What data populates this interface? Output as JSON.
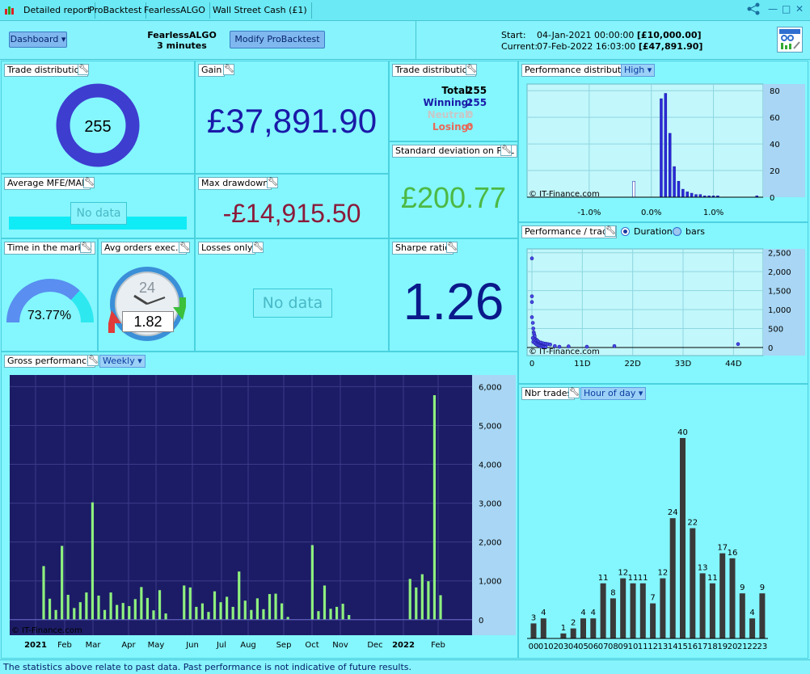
{
  "titlebar": {
    "tabs": [
      "Detailed report",
      "ProBacktest",
      "FearlessALGO",
      "Wall Street Cash (£1)"
    ]
  },
  "toolbar": {
    "dashboard_label": "Dashboard",
    "strategy_name": "FearlessALGO",
    "timeframe": "3 minutes",
    "modify_label": "Modify ProBacktest",
    "start_label": "Start:",
    "start_date": "04-Jan-2021 00:00:00",
    "start_value": "[£10,000.00]",
    "current_label": "Current:",
    "current_date": "07-Feb-2022 16:03:00",
    "current_value": "[£47,891.90]"
  },
  "trade_distribution": {
    "title": "Trade distribution",
    "total_trades": "255"
  },
  "gain": {
    "title": "Gain",
    "value": "£37,891.90"
  },
  "trade_counts": {
    "title": "Trade distribution",
    "total_label": "Total:",
    "total": "255",
    "winning_label": "Winning:",
    "winning": "255",
    "neutral_label": "Neutral:",
    "neutral": "0",
    "losing_label": "Losing:",
    "losing": "0"
  },
  "mfe_mae": {
    "title": "Average MFE/MAE",
    "nodata": "No data"
  },
  "max_drawdown": {
    "title": "Max drawdown",
    "value": "-£14,915.50"
  },
  "std_dev": {
    "title": "Standard deviation on P&L",
    "value": "£200.77"
  },
  "time_market": {
    "title": "Time in the market",
    "value": "73.77%",
    "fraction": 0.7377
  },
  "avg_orders": {
    "title": "Avg orders exec...",
    "clock": "24",
    "value": "1.82"
  },
  "losses_only": {
    "title": "Losses only",
    "nodata": "No data"
  },
  "sharpe": {
    "title": "Sharpe ratio",
    "value": "1.26"
  },
  "perf_dist": {
    "title": "Performance distribution",
    "dropdown": "High",
    "watermark": "© IT-Finance.com"
  },
  "perf_trade": {
    "title": "Performance / trade",
    "radio_duration": "Duration",
    "radio_bars": "bars",
    "watermark": "© IT-Finance.com"
  },
  "gross": {
    "title": "Gross performance",
    "dropdown": "Weekly",
    "watermark": "© IT-Finance.com"
  },
  "nbr_trades": {
    "title": "Nbr trades",
    "dropdown": "Hour of day"
  },
  "footer": {
    "text": "The statistics above relate to past data. Past performance is not indicative of future results."
  },
  "colors": {
    "background": "#7ff2fc",
    "gain": "#1a1aa8",
    "drawdown": "#8b1a3a",
    "stddev": "#4cb944",
    "sharpe": "#0a1a8a",
    "bar_green": "#8ef07e",
    "bar_dark": "#3a3a3a"
  },
  "chart_data": [
    {
      "type": "bar",
      "id": "perf_distribution",
      "x": [
        -0.003,
        0.0007,
        0.0014,
        0.0021,
        0.0028,
        0.0035,
        0.0042,
        0.0049,
        0.0056,
        0.0063,
        0.007,
        0.0077,
        0.0084,
        0.0091,
        0.0098,
        0.0105,
        0.0112,
        0.0119,
        0.0126,
        0.0133,
        0.0168
      ],
      "values": [
        12,
        0,
        74,
        78,
        48,
        23,
        12,
        6,
        4,
        3,
        2,
        2,
        1,
        1,
        1,
        1,
        0,
        0,
        0,
        0,
        1
      ],
      "xticks": [
        "-1.0%",
        "0.0%",
        "1.0%"
      ],
      "yticks": [
        0,
        20,
        40,
        60,
        80
      ],
      "ylim": [
        0,
        85
      ]
    },
    {
      "type": "scatter",
      "id": "perf_per_trade",
      "xticks": [
        "0",
        "11D",
        "22D",
        "33D",
        "44D"
      ],
      "yticks": [
        "0",
        "500",
        "1,000",
        "1,500",
        "2,000",
        "2,500"
      ],
      "ylim": [
        0,
        2600
      ],
      "xlim": [
        0,
        48
      ],
      "points": [
        [
          0,
          2350
        ],
        [
          0,
          1350
        ],
        [
          0,
          1200
        ],
        [
          0,
          800
        ],
        [
          0.2,
          650
        ],
        [
          0.3,
          500
        ],
        [
          0.4,
          400
        ],
        [
          0.5,
          350
        ],
        [
          0.6,
          300
        ],
        [
          0.2,
          250
        ],
        [
          0.8,
          220
        ],
        [
          1,
          200
        ],
        [
          1.2,
          180
        ],
        [
          1.5,
          150
        ],
        [
          2,
          130
        ],
        [
          2.5,
          110
        ],
        [
          3,
          100
        ],
        [
          3.5,
          90
        ],
        [
          0.5,
          200
        ],
        [
          0.7,
          160
        ],
        [
          1,
          120
        ],
        [
          1.3,
          100
        ],
        [
          1.6,
          80
        ],
        [
          1.9,
          60
        ],
        [
          2.2,
          50
        ],
        [
          0.3,
          150
        ],
        [
          0.6,
          120
        ],
        [
          0.9,
          90
        ],
        [
          1.2,
          70
        ],
        [
          1.5,
          50
        ],
        [
          1.8,
          40
        ],
        [
          2.1,
          30
        ],
        [
          2.4,
          20
        ],
        [
          2.7,
          15
        ],
        [
          3,
          10
        ],
        [
          4,
          80
        ],
        [
          5,
          40
        ],
        [
          6,
          20
        ],
        [
          8,
          30
        ],
        [
          12,
          20
        ],
        [
          18,
          40
        ],
        [
          45,
          90
        ]
      ]
    },
    {
      "type": "bar",
      "id": "gross_performance",
      "yticks": [
        "0",
        "1,000",
        "2,000",
        "3,000",
        "4,000",
        "5,000",
        "6,000"
      ],
      "ylim": [
        -400,
        6300
      ],
      "xticks": [
        "2021",
        "Feb",
        "Mar",
        "Apr",
        "May",
        "Jun",
        "Jul",
        "Aug",
        "Sep",
        "Oct",
        "Nov",
        "Dec",
        "2022",
        "Feb"
      ],
      "values": [
        1380,
        540,
        250,
        1900,
        640,
        300,
        450,
        700,
        3020,
        620,
        250,
        700,
        380,
        430,
        350,
        530,
        840,
        560,
        240,
        760,
        160,
        0,
        0,
        880,
        830,
        330,
        420,
        200,
        730,
        450,
        590,
        330,
        1240,
        490,
        250,
        550,
        270,
        660,
        670,
        420,
        70,
        0,
        0,
        0,
        1920,
        220,
        880,
        280,
        330,
        410,
        120,
        0,
        0,
        0,
        0,
        0,
        0,
        0,
        0,
        0,
        1050,
        830,
        1170,
        990,
        5780,
        630
      ]
    },
    {
      "type": "bar",
      "id": "nbr_trades_hour",
      "categories": [
        "00",
        "01",
        "02",
        "03",
        "04",
        "05",
        "06",
        "07",
        "08",
        "09",
        "10",
        "11",
        "12",
        "13",
        "14",
        "15",
        "16",
        "17",
        "18",
        "19",
        "20",
        "21",
        "22",
        "23"
      ],
      "values": [
        3,
        4,
        0,
        1,
        2,
        4,
        4,
        11,
        8,
        12,
        11,
        11,
        7,
        12,
        24,
        40,
        22,
        13,
        11,
        17,
        16,
        9,
        4,
        9
      ]
    }
  ]
}
